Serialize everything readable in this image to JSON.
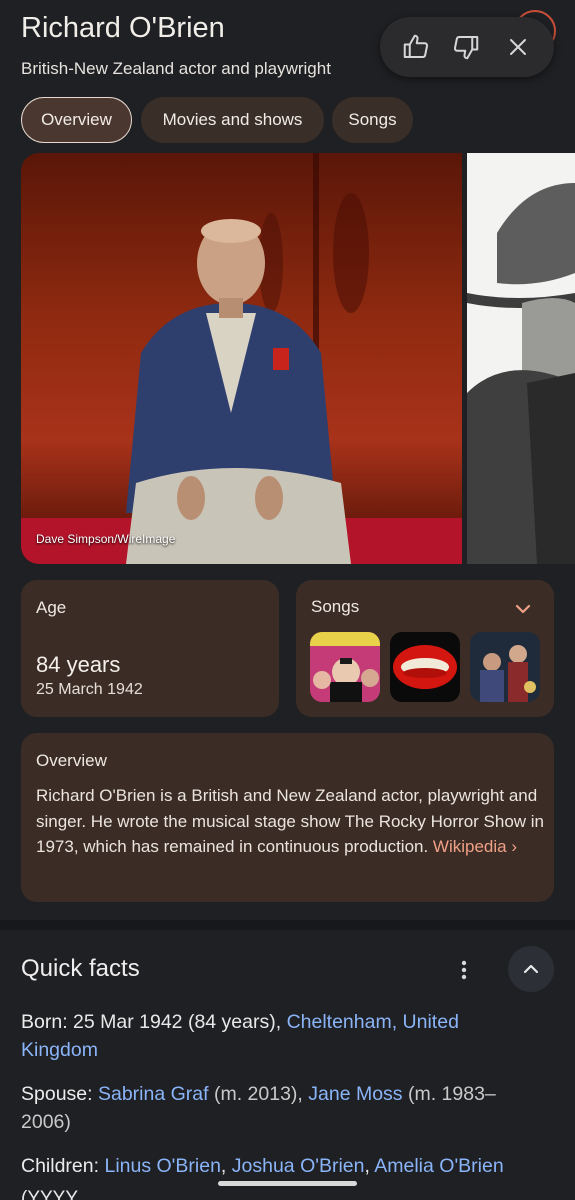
{
  "header": {
    "title": "Richard O'Brien",
    "subtitle": "British-New Zealand actor and playwright"
  },
  "feedback": {
    "icons": [
      "thumbs-up-icon",
      "thumbs-down-icon",
      "close-icon"
    ]
  },
  "tabs": [
    {
      "label": "Overview",
      "active": true
    },
    {
      "label": "Movies and shows",
      "active": false
    },
    {
      "label": "Songs",
      "active": false
    }
  ],
  "photo": {
    "credit": "Dave Simpson/WireImage"
  },
  "age_card": {
    "label": "Age",
    "value": "84 years",
    "date": "25 March 1942"
  },
  "songs_card": {
    "label": "Songs",
    "thumbnails": [
      "album-art-rocky-horror",
      "red-lips-art",
      "movie-still"
    ]
  },
  "overview_card": {
    "label": "Overview",
    "text": "Richard O'Brien is a British and New Zealand actor, playwright and singer. He wrote the musical stage show The Rocky Horror Show in 1973, which has remained in continuous production. ",
    "source_link": "Wikipedia",
    "source_chevron": "›"
  },
  "quick_facts": {
    "title": "Quick facts",
    "born": {
      "label": "Born",
      "text": ": 25 Mar 1942 (84 years), ",
      "place_link": "Cheltenham, United Kingdom"
    },
    "spouse": {
      "label": "Spouse",
      "sep": ": ",
      "spouse1": "Sabrina Graf",
      "spouse1_detail": " (m. 2013), ",
      "spouse2": "Jane Moss",
      "spouse2_detail": " (m. 1983–2006)"
    },
    "children": {
      "label": "Children",
      "sep": ": ",
      "child1": "Linus O'Brien",
      "comma1": ", ",
      "child2": "Joshua O'Brien",
      "comma2": ", ",
      "child3": "Amelia O'Brien"
    },
    "cut_off_text": "(YYYY..."
  },
  "colors": {
    "background": "#1f2023",
    "card": "#3b2d26",
    "link": "#8ab4f8",
    "wiki_link": "#f0a086"
  }
}
